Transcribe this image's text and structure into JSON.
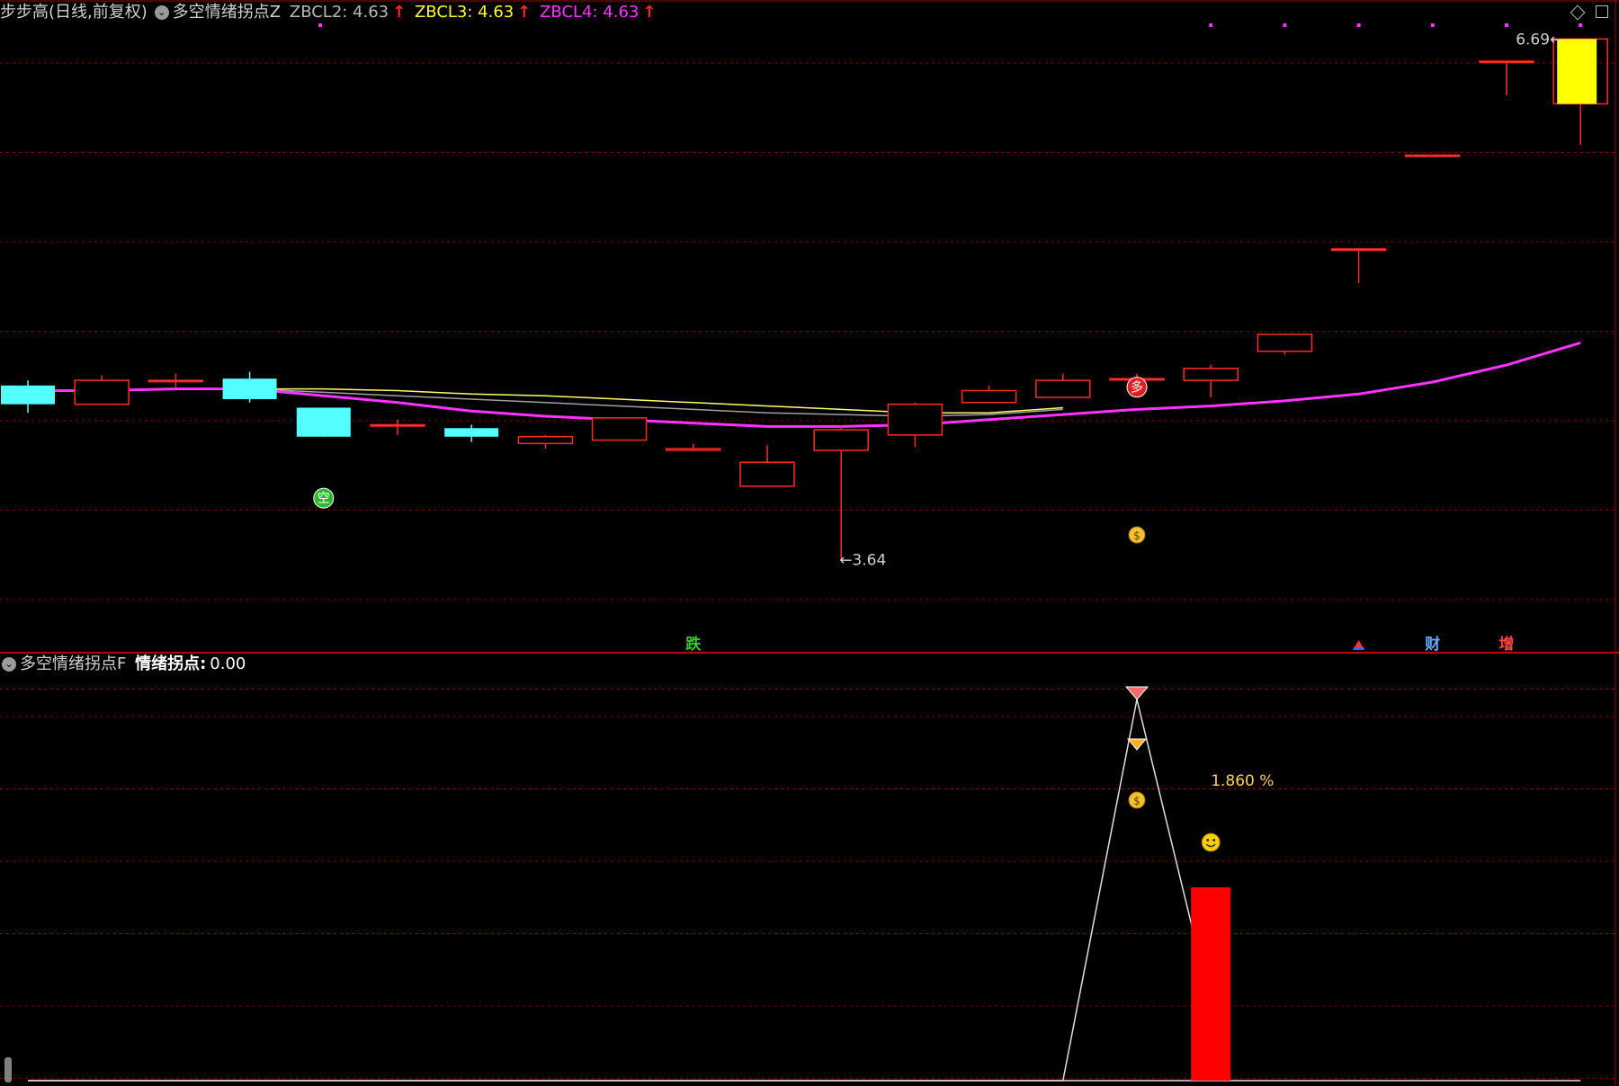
{
  "header": {
    "stock_title": "步步高(日线,前复权)",
    "indicator_name": "多空情绪拐点Z",
    "values": [
      {
        "label": "ZBCL2: 4.63",
        "color": "#c0c0c0"
      },
      {
        "label": "ZBCL3: 4.63",
        "color": "#ffff33"
      },
      {
        "label": "ZBCL4: 4.63",
        "color": "#ff33ff"
      }
    ],
    "up_arrow": "↑"
  },
  "sub_header": {
    "indicator_name": "多空情绪拐点F",
    "label": "情绪拐点:",
    "value": "0.00"
  },
  "colors": {
    "up": "#ff2a2a",
    "down": "#54ffff",
    "ma_main": "#ff33ff",
    "ma_yellow": "#ffff66",
    "ma_gray": "#a0a0a0",
    "grid": "#7a0000",
    "peak_line": "#e0e0e0",
    "last_candle": "#ffff00"
  },
  "chart_data": [
    {
      "type": "candlestick",
      "title": "步步高(日线,前复权)",
      "ylim": [
        3.4,
        6.75
      ],
      "candles": [
        {
          "o": 4.66,
          "h": 4.69,
          "l": 4.5,
          "c": 4.55
        },
        {
          "o": 4.55,
          "h": 4.72,
          "l": 4.55,
          "c": 4.69
        },
        {
          "o": 4.69,
          "h": 4.73,
          "l": 4.65,
          "c": 4.69
        },
        {
          "o": 4.7,
          "h": 4.74,
          "l": 4.56,
          "c": 4.58
        },
        {
          "o": 4.53,
          "h": 4.53,
          "l": 4.36,
          "c": 4.36
        },
        {
          "o": 4.43,
          "h": 4.46,
          "l": 4.37,
          "c": 4.43
        },
        {
          "o": 4.41,
          "h": 4.43,
          "l": 4.33,
          "c": 4.36
        },
        {
          "o": 4.32,
          "h": 4.37,
          "l": 4.29,
          "c": 4.36
        },
        {
          "o": 4.34,
          "h": 4.47,
          "l": 4.34,
          "c": 4.47
        },
        {
          "o": 4.28,
          "h": 4.32,
          "l": 4.28,
          "c": 4.29
        },
        {
          "o": 4.07,
          "h": 4.31,
          "l": 4.07,
          "c": 4.21
        },
        {
          "o": 4.28,
          "h": 4.42,
          "l": 3.64,
          "c": 4.4
        },
        {
          "o": 4.37,
          "h": 4.56,
          "l": 4.3,
          "c": 4.55
        },
        {
          "o": 4.56,
          "h": 4.66,
          "l": 4.56,
          "c": 4.63
        },
        {
          "o": 4.59,
          "h": 4.73,
          "l": 4.59,
          "c": 4.69
        },
        {
          "o": 4.7,
          "h": 4.73,
          "l": 4.59,
          "c": 4.7
        },
        {
          "o": 4.69,
          "h": 4.78,
          "l": 4.59,
          "c": 4.76
        },
        {
          "o": 4.86,
          "h": 4.96,
          "l": 4.84,
          "c": 4.96
        },
        {
          "o": 5.46,
          "h": 5.46,
          "l": 5.26,
          "c": 5.46
        },
        {
          "o": 6.01,
          "h": 6.01,
          "l": 6.01,
          "c": 6.01
        },
        {
          "o": 6.56,
          "h": 6.56,
          "l": 6.36,
          "c": 6.56
        },
        {
          "o": 6.31,
          "h": 6.69,
          "l": 6.07,
          "c": 6.69
        }
      ],
      "series": [
        {
          "name": "ZBCL4",
          "values": [
            4.63,
            4.63,
            4.64,
            4.64,
            4.6,
            4.56,
            4.51,
            4.48,
            4.46,
            4.44,
            4.42,
            4.42,
            4.43,
            4.46,
            4.49,
            4.52,
            4.54,
            4.57,
            4.61,
            4.68,
            4.78,
            4.91
          ]
        }
      ],
      "grey_line": [
        4.63,
        4.63,
        4.64,
        4.64,
        4.62,
        4.6,
        4.58,
        4.56,
        4.54,
        4.52,
        4.5,
        4.49,
        4.48,
        4.49,
        4.52
      ],
      "yellow_line": [
        4.63,
        4.63,
        4.64,
        4.64,
        4.64,
        4.63,
        4.61,
        4.6,
        4.58,
        4.56,
        4.54,
        4.52,
        4.5,
        4.5,
        4.53
      ],
      "annotations": [
        {
          "text": "6.69",
          "arrow": "←",
          "index": 21,
          "y": 6.69
        },
        {
          "text": "3.64",
          "arrow": "←",
          "index": 11,
          "y": 3.64
        }
      ],
      "signals": [
        {
          "text": "空",
          "index": 4,
          "y": 4.0,
          "color": "#2eb82e"
        },
        {
          "text": "多",
          "index": 15,
          "y": 4.65,
          "color": "#e02020"
        }
      ],
      "bottom_markers": [
        {
          "text": "跌",
          "index": 9,
          "color": "#33cc33"
        },
        {
          "text": "财",
          "index": 19,
          "color": "#66aaff"
        },
        {
          "text": "增",
          "index": 20,
          "color": "#ff4444"
        }
      ],
      "top_dots_from_index": 16
    },
    {
      "type": "line",
      "title": "多空情绪拐点F",
      "ylim": [
        0,
        100
      ],
      "line_points": [
        [
          0,
          0
        ],
        [
          14,
          0
        ],
        [
          15,
          100
        ],
        [
          16,
          20
        ]
      ],
      "bar": {
        "index": 16,
        "value": 50
      },
      "label": {
        "text": "1.860 %",
        "color": "#ffd24d"
      }
    }
  ]
}
